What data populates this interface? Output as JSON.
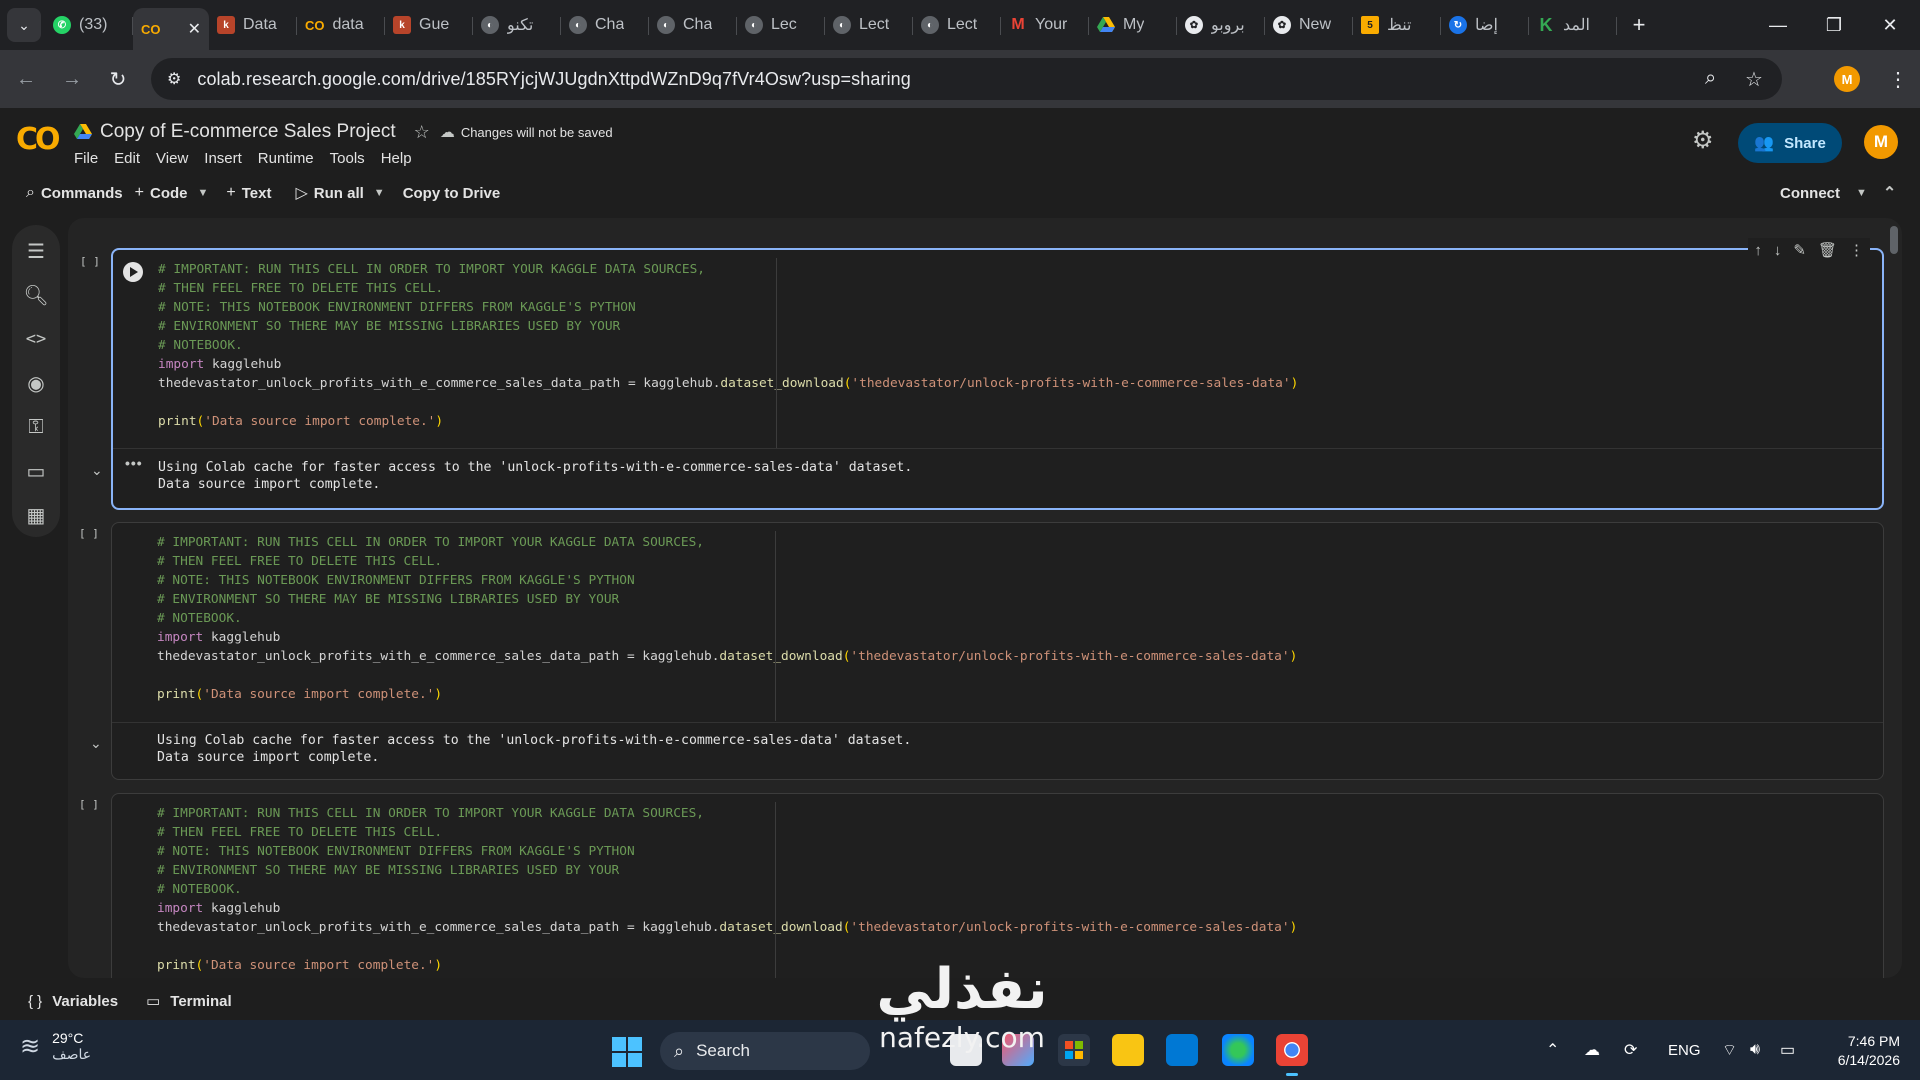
{
  "browser": {
    "tabs": [
      {
        "label": "(33)",
        "favicon": "whatsapp-icon"
      },
      {
        "label": "",
        "favicon": "colab-icon",
        "active": true
      },
      {
        "label": "Data",
        "favicon": "kaggle-icon"
      },
      {
        "label": "data",
        "favicon": "colab-icon"
      },
      {
        "label": "Gue",
        "favicon": "kaggle-icon"
      },
      {
        "label": "تكنو",
        "favicon": "globe-icon"
      },
      {
        "label": "Cha",
        "favicon": "globe-icon"
      },
      {
        "label": "Cha",
        "favicon": "globe-icon"
      },
      {
        "label": "Lec",
        "favicon": "globe-icon"
      },
      {
        "label": "Lect",
        "favicon": "globe-icon"
      },
      {
        "label": "Lect",
        "favicon": "globe-icon"
      },
      {
        "label": "Your",
        "favicon": "gmail-icon"
      },
      {
        "label": "My",
        "favicon": "drive-icon"
      },
      {
        "label": "بروبو",
        "favicon": "openai-icon"
      },
      {
        "label": "New",
        "favicon": "chatgpt-icon"
      },
      {
        "label": "تنظ",
        "favicon": "five-icon"
      },
      {
        "label": "إضا",
        "favicon": "refresh-icon"
      },
      {
        "label": "المد",
        "favicon": "k-icon"
      }
    ],
    "url": "colab.research.google.com/drive/185RYjcjWJUgdnXttpdWZnD9q7fVr4Osw?usp=sharing",
    "profile_initial": "M"
  },
  "colab": {
    "title": "Copy of E-commerce Sales Project",
    "save_note": "Changes will not be saved",
    "menu": [
      "File",
      "Edit",
      "View",
      "Insert",
      "Runtime",
      "Tools",
      "Help"
    ],
    "toolbar": {
      "commands": "Commands",
      "code": "Code",
      "text": "Text",
      "run_all": "Run all",
      "copy_to_drive": "Copy to Drive",
      "connect": "Connect"
    },
    "share_label": "Share",
    "avatar_initial": "M"
  },
  "cells": [
    {
      "exec_count": "[ ]",
      "output": [
        "Using Colab cache for faster access to the 'unlock-profits-with-e-commerce-sales-data' dataset.",
        "Data source import complete."
      ]
    },
    {
      "exec_count": "[ ]",
      "output": [
        "Using Colab cache for faster access to the 'unlock-profits-with-e-commerce-sales-data' dataset.",
        "Data source import complete."
      ]
    },
    {
      "exec_count": "[ ]",
      "output": []
    }
  ],
  "code": {
    "comment_lines": [
      "# IMPORTANT: RUN THIS CELL IN ORDER TO IMPORT YOUR KAGGLE DATA SOURCES,",
      "# THEN FEEL FREE TO DELETE THIS CELL.",
      "# NOTE: THIS NOTEBOOK ENVIRONMENT DIFFERS FROM KAGGLE'S PYTHON",
      "# ENVIRONMENT SO THERE MAY BE MISSING LIBRARIES USED BY YOUR",
      "# NOTEBOOK."
    ],
    "import_kw": "import",
    "import_mod": "kagglehub",
    "assign_lhs": "thedevastator_unlock_profits_with_e_commerce_sales_data_path = kagglehub.",
    "assign_fn": "dataset_download",
    "assign_str": "'thedevastator/unlock-profits-with-e-commerce-sales-data'",
    "print_fn": "print",
    "print_str": "'Data source import complete.'"
  },
  "statusbar": {
    "variables": "Variables",
    "terminal": "Terminal"
  },
  "taskbar": {
    "temperature": "29°C",
    "weather": "عاصف",
    "search": "Search",
    "language": "ENG",
    "time": "7:46 PM",
    "date": "6/14/2026"
  },
  "watermark": {
    "arabic": "نفذلي",
    "english": "nafezly.com"
  },
  "colors": {
    "accent": "#8ab4f8",
    "colab_orange": "#f9ab00",
    "share_bg": "#004a77"
  }
}
